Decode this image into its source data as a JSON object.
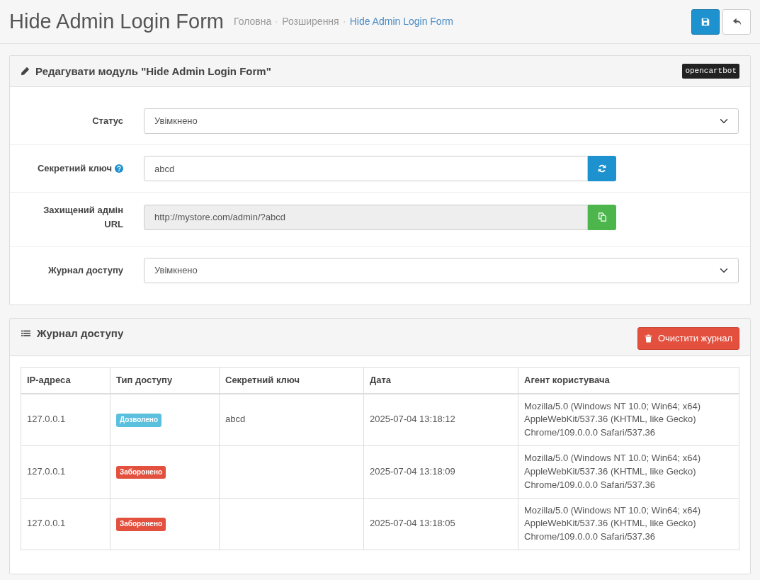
{
  "page_title": "Hide Admin Login Form",
  "breadcrumb": [
    {
      "label": "Головна",
      "current": false
    },
    {
      "label": "Розширення",
      "current": false
    },
    {
      "label": "Hide Admin Login Form",
      "current": true
    }
  ],
  "edit_panel": {
    "title": "Редагувати модуль \"Hide Admin Login Form\"",
    "badge": "opencartbot",
    "fields": [
      {
        "kind": "select",
        "label": "Статус",
        "help": false,
        "value": "Увімкнено"
      },
      {
        "kind": "input_refresh",
        "label": "Секретний ключ",
        "help": true,
        "value": "abcd"
      },
      {
        "kind": "readonly_copy",
        "label": "Захищений адмін URL",
        "help": false,
        "value": "http://mystore.com/admin/?abcd"
      },
      {
        "kind": "select",
        "label": "Журнал доступу",
        "help": false,
        "value": "Увімкнено"
      }
    ]
  },
  "log_panel": {
    "title": "Журнал доступу",
    "clear_button": "Очистити журнал",
    "table": {
      "columns": [
        "IP-адреса",
        "Тип доступу",
        "Секретний ключ",
        "Дата",
        "Агент користувача"
      ],
      "rows": [
        {
          "ip": "127.0.0.1",
          "access": {
            "kind": "allowed",
            "label": "Дозволено"
          },
          "key": "abcd",
          "date": "2025-07-04 13:18:12",
          "agent": "Mozilla/5.0 (Windows NT 10.0; Win64; x64) AppleWebKit/537.36 (KHTML, like Gecko) Chrome/109.0.0.0 Safari/537.36"
        },
        {
          "ip": "127.0.0.1",
          "access": {
            "kind": "denied",
            "label": "Заборонено"
          },
          "key": "",
          "date": "2025-07-04 13:18:09",
          "agent": "Mozilla/5.0 (Windows NT 10.0; Win64; x64) AppleWebKit/537.36 (KHTML, like Gecko) Chrome/109.0.0.0 Safari/537.36"
        },
        {
          "ip": "127.0.0.1",
          "access": {
            "kind": "denied",
            "label": "Заборонено"
          },
          "key": "",
          "date": "2025-07-04 13:18:05",
          "agent": "Mozilla/5.0 (Windows NT 10.0; Win64; x64) AppleWebKit/537.36 (KHTML, like Gecko) Chrome/109.0.0.0 Safari/537.36"
        }
      ]
    }
  }
}
